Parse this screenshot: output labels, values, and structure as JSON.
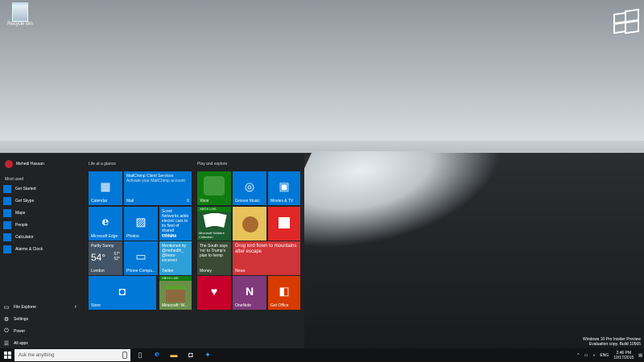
{
  "desktop": {
    "recycle_bin_label": "Recycle Bin",
    "watermark": [
      "Windows 10 Pro Insider Preview",
      "Evaluation copy. Build 10565"
    ]
  },
  "start_menu": {
    "user_name": "Mehedi Hassan",
    "most_used_label": "Most used",
    "most_used": [
      {
        "label": "Get Started",
        "icon": "lightbulb-icon"
      },
      {
        "label": "Get Skype",
        "icon": "skype-icon"
      },
      {
        "label": "Maps",
        "icon": "maps-icon"
      },
      {
        "label": "People",
        "icon": "people-icon"
      },
      {
        "label": "Calculator",
        "icon": "calculator-icon"
      },
      {
        "label": "Alarms & Clock",
        "icon": "alarm-icon"
      }
    ],
    "bottom": [
      {
        "label": "File Explorer",
        "icon": "folder-icon"
      },
      {
        "label": "Settings",
        "icon": "gear-icon"
      },
      {
        "label": "Power",
        "icon": "power-icon"
      },
      {
        "label": "All apps",
        "icon": "list-icon"
      }
    ],
    "group_life": "Life at a glance",
    "group_play": "Play and explore",
    "tiles": {
      "calendar": "Calendar",
      "mail_title": "MailChimp Client Services",
      "mail_body": "Activate your MailChimp account",
      "mail_label": "Mail",
      "mail_count": "6",
      "edge": "Microsoft Edge",
      "photos": "Photos",
      "cortana_body": "Scoot Networks adds electric cars to its fleet of shared vehicles",
      "cortana": "Cortana",
      "weather_cond": "Partly Sunny",
      "weather_temp": "54°",
      "weather_hi": "57°",
      "weather_lo": "52°",
      "weather_city": "London",
      "phone": "Phone Compa...",
      "twitter_body": "Mentioned by @mehedih_ @feers-excerect",
      "twitter": "Twitter",
      "store": "Store",
      "minecraft": "Minecraft: W...",
      "xbox_live": "XBOX LIVE",
      "xbox": "Xbox",
      "groove": "Groove Music",
      "movies": "Movies & TV",
      "solitaire": "Microsoft Solitaire Collection",
      "money_body": "The South says 'no' to Trump’s plan to hemp",
      "money": "Money",
      "news_body": "Drug lord flown to mountains after escape",
      "news": "News",
      "onenote": "OneNote",
      "office": "Get Office"
    }
  },
  "taskbar": {
    "search_placeholder": "Ask me anything",
    "language": "ENG",
    "time": "2:46 PM",
    "date": "10/17/2015"
  },
  "colors": {
    "accent": "#0078d7",
    "start_bg": "#202224",
    "taskbar_bg": "#111315",
    "news_red": "#d13438",
    "onenote_purple": "#80397b",
    "office_orange": "#d83b01",
    "xbox_green": "#107c10",
    "iheart_red": "#c6002b",
    "flipboard_red": "#e12828"
  }
}
